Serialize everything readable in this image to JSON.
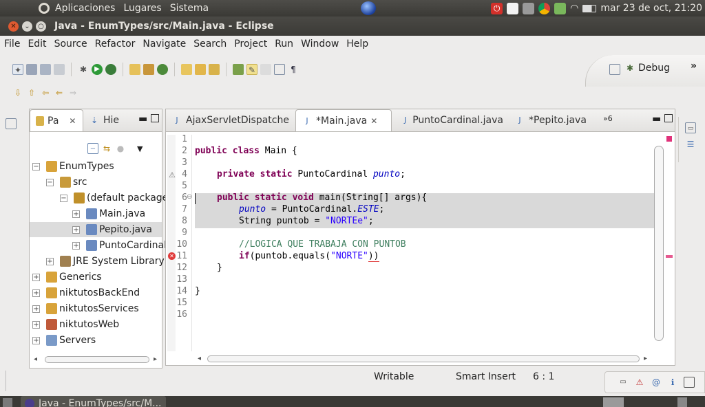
{
  "top_panel": {
    "menus": [
      "Aplicaciones",
      "Lugares",
      "Sistema"
    ],
    "clock": "mar 23 de oct, 21:20"
  },
  "window": {
    "title": "Java - EnumTypes/src/Main.java - Eclipse"
  },
  "menubar": [
    "File",
    "Edit",
    "Source",
    "Refactor",
    "Navigate",
    "Search",
    "Project",
    "Run",
    "Window",
    "Help"
  ],
  "perspective": {
    "label": "Debug"
  },
  "left_view": {
    "tabs": [
      {
        "label": "Pa",
        "icon": "package-explorer-icon"
      },
      {
        "label": "Hie",
        "icon": "hierarchy-icon"
      }
    ],
    "tree": [
      {
        "label": "EnumTypes",
        "expander": "−",
        "icon": "java-project-icon"
      },
      {
        "label": "src",
        "expander": "−",
        "icon": "source-folder-icon"
      },
      {
        "label": "(default package",
        "expander": "−",
        "icon": "package-icon"
      },
      {
        "label": "Main.java",
        "expander": "+",
        "icon": "java-file-icon"
      },
      {
        "label": "Pepito.java",
        "expander": "+",
        "icon": "java-file-icon",
        "selected": true
      },
      {
        "label": "PuntoCardinal",
        "expander": "+",
        "icon": "java-file-icon"
      },
      {
        "label": "JRE System Library [",
        "expander": "+",
        "icon": "library-icon"
      },
      {
        "label": "Generics",
        "expander": "+",
        "icon": "java-project-icon"
      },
      {
        "label": "niktutosBackEnd",
        "expander": "+",
        "icon": "java-project-icon"
      },
      {
        "label": "niktutosServices",
        "expander": "+",
        "icon": "java-project-icon"
      },
      {
        "label": "niktutosWeb",
        "expander": "+",
        "icon": "web-project-icon"
      },
      {
        "label": "Servers",
        "expander": "+",
        "icon": "folder-icon"
      }
    ]
  },
  "editor": {
    "tabs": [
      {
        "label": "AjaxServletDispatche",
        "active": false
      },
      {
        "label": "*Main.java",
        "active": true
      },
      {
        "label": "PuntoCardinal.java",
        "active": false
      },
      {
        "label": "*Pepito.java",
        "active": false
      }
    ],
    "overflow": "»6",
    "line_numbers": [
      "1",
      "2",
      "3",
      "4",
      "5",
      "6",
      "7",
      "8",
      "9",
      "10",
      "11",
      "12",
      "13",
      "14",
      "15",
      "16"
    ],
    "code": {
      "l2_kw": "public class",
      "l2_rest": " Main {",
      "l4_kw": "private static",
      "l4_type": " PuntoCardinal ",
      "l4_fld": "punto",
      "l4_end": ";",
      "l6_kw": "public static void",
      "l6_rest": " main(String[] args){",
      "l7_fld": "punto",
      "l7_mid": " = PuntoCardinal.",
      "l7_const": "ESTE",
      "l7_end": ";",
      "l8_pre": "String puntob = ",
      "l8_str": "\"NORTEe\"",
      "l8_end": ";",
      "l10_cmt": "//LOGICA QUE TRABAJA CON PUNTOB",
      "l11_kw": "if",
      "l11_mid": "(puntob.equals(",
      "l11_str": "\"NORTE\"",
      "l11_end": "))",
      "l12": "}",
      "l14": "}"
    }
  },
  "status": {
    "writable": "Writable",
    "insert_mode": "Smart Insert",
    "position": "6 : 1"
  },
  "taskbar": {
    "item": "Java - EnumTypes/src/M..."
  }
}
